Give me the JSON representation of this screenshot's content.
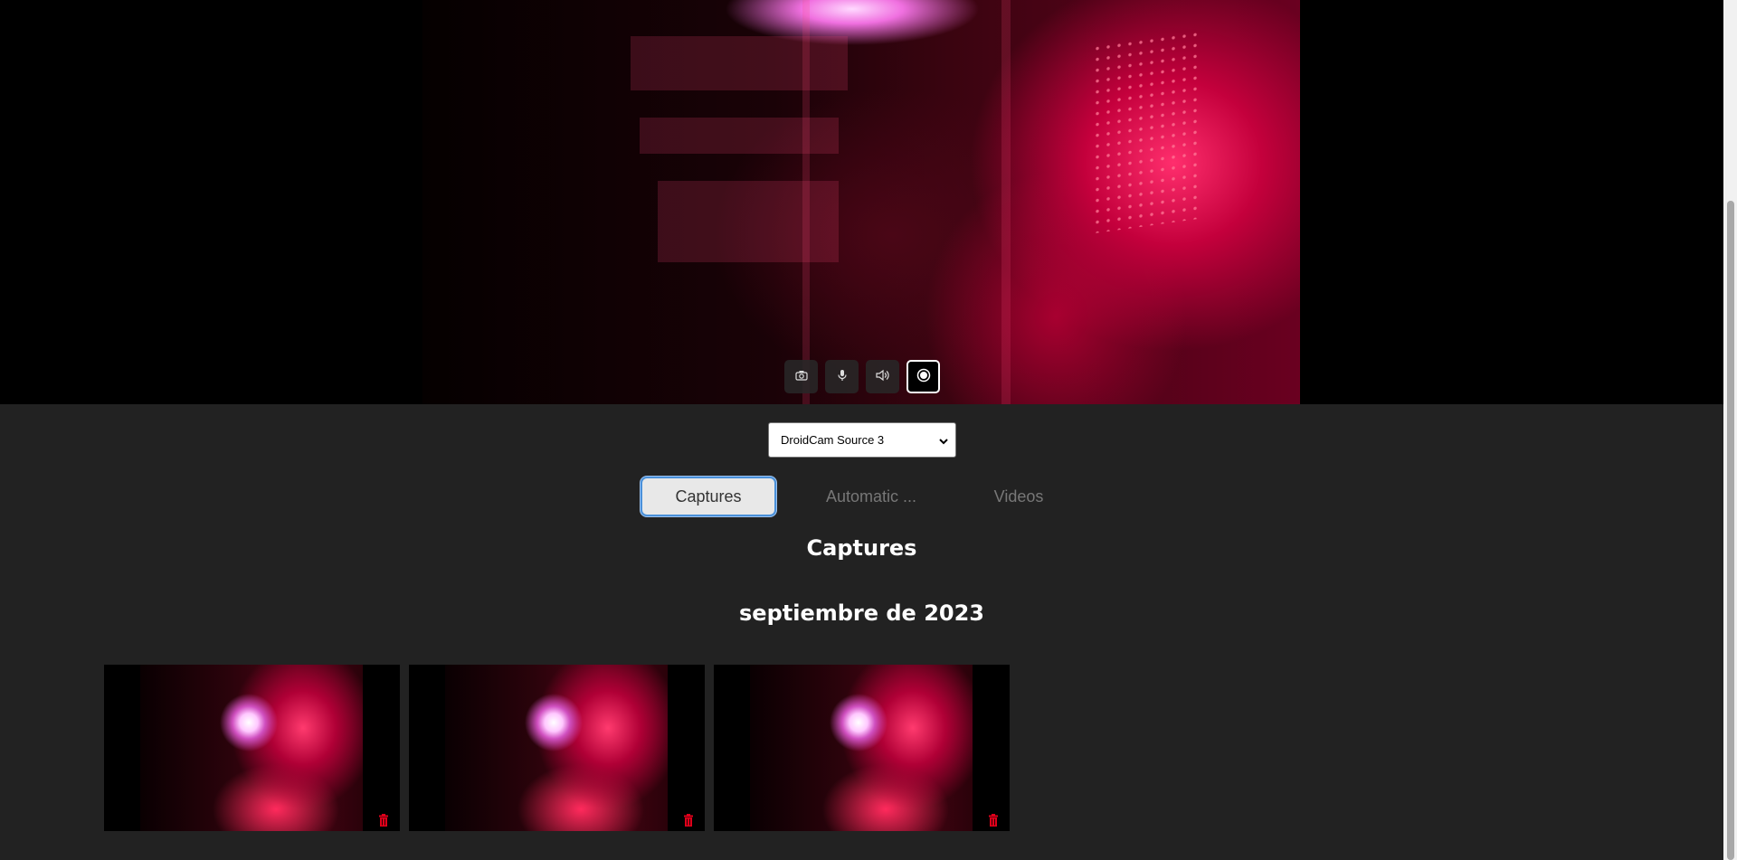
{
  "video": {
    "controls": [
      {
        "name": "camera-button",
        "icon": "camera-icon"
      },
      {
        "name": "microphone-button",
        "icon": "microphone-icon"
      },
      {
        "name": "speaker-button",
        "icon": "speaker-icon"
      },
      {
        "name": "record-button",
        "icon": "record-icon"
      }
    ]
  },
  "source_select": {
    "selected": "DroidCam Source 3"
  },
  "tabs": [
    {
      "label": "Captures",
      "active": true
    },
    {
      "label": "Automatic ...",
      "active": false
    },
    {
      "label": "Videos",
      "active": false
    }
  ],
  "section": {
    "title": "Captures",
    "month": "septiembre de 2023"
  },
  "thumbnails": [
    {
      "caption": "",
      "delete_icon": "trash-icon"
    },
    {
      "caption": "",
      "delete_icon": "trash-icon"
    },
    {
      "caption": "",
      "delete_icon": "trash-icon"
    }
  ],
  "colors": {
    "page_bg": "#222222",
    "active_tab_border": "#4a90d9",
    "delete_icon": "#e0001a"
  }
}
